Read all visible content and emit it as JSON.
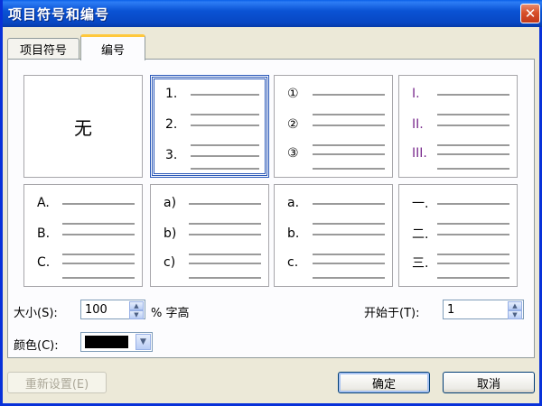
{
  "window": {
    "title": "项目符号和编号",
    "close_glyph": "✕"
  },
  "tabs": [
    {
      "label": "项目符号"
    },
    {
      "label": "编号"
    }
  ],
  "gallery": {
    "none_label": "无",
    "row1": [
      {
        "markers": []
      },
      {
        "markers": [
          "1.",
          "2.",
          "3."
        ],
        "selected": true
      },
      {
        "markers": [
          "①",
          "②",
          "③"
        ]
      },
      {
        "markers": [
          "I.",
          "II.",
          "III."
        ],
        "color": "#7a2c8e"
      }
    ],
    "row2": [
      {
        "markers": [
          "A.",
          "B.",
          "C."
        ]
      },
      {
        "markers": [
          "a)",
          "b)",
          "c)"
        ]
      },
      {
        "markers": [
          "a.",
          "b.",
          "c."
        ]
      },
      {
        "markers": [
          "一.",
          "二.",
          "三."
        ]
      }
    ]
  },
  "size": {
    "label": "大小(S):",
    "value": "100",
    "unit": "% 字高"
  },
  "start_at": {
    "label": "开始于(T):",
    "value": "1"
  },
  "color": {
    "label": "颜色(C):",
    "value": "#000000"
  },
  "buttons": {
    "reset": "重新设置(E)",
    "ok": "确定",
    "cancel": "取消"
  }
}
